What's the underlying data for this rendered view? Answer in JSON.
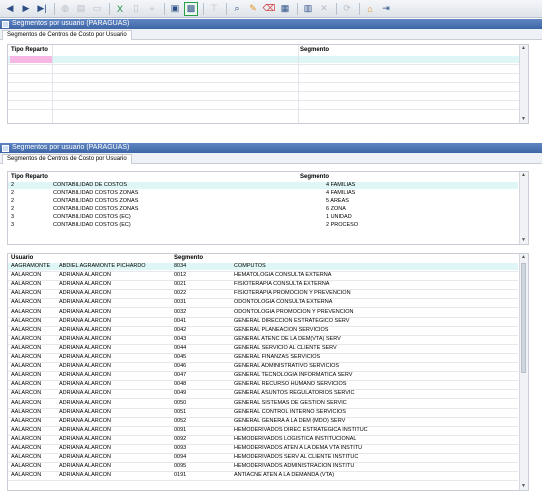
{
  "toolbar": {
    "buttons": [
      {
        "name": "first-record",
        "icon": "first-record-icon",
        "glyph": "◀",
        "enabled": true
      },
      {
        "name": "next-record",
        "icon": "next-record-icon",
        "glyph": "▶",
        "enabled": true
      },
      {
        "name": "last-record",
        "icon": "last-record-icon",
        "glyph": "▶|",
        "enabled": true
      },
      {
        "name": "globe",
        "icon": "globe-icon",
        "glyph": "◍",
        "enabled": false
      },
      {
        "name": "print",
        "icon": "print-icon",
        "glyph": "▤",
        "enabled": false
      },
      {
        "name": "screen",
        "icon": "screen-icon",
        "glyph": "▭",
        "enabled": false
      },
      {
        "name": "excel",
        "icon": "excel-icon",
        "glyph": "X",
        "enabled": true
      },
      {
        "name": "copy",
        "icon": "copy-icon",
        "glyph": "▯",
        "enabled": false
      },
      {
        "name": "add",
        "icon": "add-icon",
        "glyph": "+",
        "enabled": false
      },
      {
        "name": "save-disk",
        "icon": "disk-icon",
        "glyph": "▣",
        "enabled": true
      },
      {
        "name": "selected-tool",
        "icon": "database-icon",
        "glyph": "▩",
        "enabled": true,
        "selected": true
      },
      {
        "name": "filter",
        "icon": "filter-icon",
        "glyph": "⊤",
        "enabled": false
      },
      {
        "name": "search",
        "icon": "search-icon",
        "glyph": "⌕",
        "enabled": true
      },
      {
        "name": "edit",
        "icon": "pencil-icon",
        "glyph": "✎",
        "enabled": true
      },
      {
        "name": "erase",
        "icon": "eraser-icon",
        "glyph": "⌫",
        "enabled": true
      },
      {
        "name": "form",
        "icon": "form-icon",
        "glyph": "▦",
        "enabled": true
      },
      {
        "name": "save",
        "icon": "save-icon",
        "glyph": "▥",
        "enabled": true
      },
      {
        "name": "delete",
        "icon": "delete-icon",
        "glyph": "✕",
        "enabled": false
      },
      {
        "name": "refresh",
        "icon": "refresh-icon",
        "glyph": "⟳",
        "enabled": false
      },
      {
        "name": "home",
        "icon": "home-icon",
        "glyph": "⌂",
        "enabled": true
      },
      {
        "name": "exit",
        "icon": "exit-icon",
        "glyph": "⇥",
        "enabled": true
      }
    ]
  },
  "panel1": {
    "title": "Segmentos por usuario (PARAGUAS)",
    "tab": "Segmentos de Centros de Costo por Usuario",
    "col_tipo": "Tipo Reparto",
    "col_segmento": "Segmento"
  },
  "panel2": {
    "title": "Segmentos por usuario (PARAGUAS)",
    "tab": "Segmentos de Centros de Costo por Usuario",
    "col_tipo": "Tipo Reparto",
    "col_segmento": "Segmento",
    "reparto_rows": [
      {
        "code": "2",
        "desc": "CONTABILIDAD DE COSTOS",
        "seg": "4 FAMILIAS"
      },
      {
        "code": "2",
        "desc": "CONTABILIDAD COSTOS ZONAS",
        "seg": "4 FAMILIAS"
      },
      {
        "code": "2",
        "desc": "CONTABILIDAD COSTOS ZONAS",
        "seg": "5 AREAS"
      },
      {
        "code": "2",
        "desc": "CONTABILIDAD COSTOS ZONAS",
        "seg": "6 ZONA"
      },
      {
        "code": "3",
        "desc": "CONTABILIDAD COSTOS (EC)",
        "seg": "1 UNIDAD"
      },
      {
        "code": "3",
        "desc": "CONTABILIDAD COSTOS (EC)",
        "seg": "2 PROCESO"
      }
    ],
    "col_usuario": "Usuario",
    "col_segmento2": "Segmento",
    "user_rows": [
      {
        "user": "AAGRAMONTE",
        "name": "ABDIEL AGRAMONTE PICHARDO",
        "code": "8034",
        "desc": "COMPUTOS"
      },
      {
        "user": "AALARCON",
        "name": "ADRIANA ALARCON",
        "code": "0012",
        "desc": "HEMATOLOGIA CONSULTA EXTERNA"
      },
      {
        "user": "AALARCON",
        "name": "ADRIANA ALARCON",
        "code": "0021",
        "desc": "FISIOTERAPIA CONSULTA EXTERNA"
      },
      {
        "user": "AALARCON",
        "name": "ADRIANA ALARCON",
        "code": "0022",
        "desc": "FISIOTERAPIA PROMOCION Y PREVENCION"
      },
      {
        "user": "AALARCON",
        "name": "ADRIANA ALARCON",
        "code": "0031",
        "desc": "ODONTOLOGIA CONSULTA EXTERNA"
      },
      {
        "user": "AALARCON",
        "name": "ADRIANA ALARCON",
        "code": "0032",
        "desc": "ODONTOLOGIA PROMOCION Y PREVENCION"
      },
      {
        "user": "AALARCON",
        "name": "ADRIANA ALARCON",
        "code": "0041",
        "desc": "GENERAL DIRECCION ESTRATEGICO SERV"
      },
      {
        "user": "AALARCON",
        "name": "ADRIANA ALARCON",
        "code": "0042",
        "desc": "GENERAL PLANEACION SERVICIOS"
      },
      {
        "user": "AALARCON",
        "name": "ADRIANA ALARCON",
        "code": "0043",
        "desc": "GENERAL ATENC DE LA DEM(VTA) SERV"
      },
      {
        "user": "AALARCON",
        "name": "ADRIANA ALARCON",
        "code": "0044",
        "desc": "GENERAL SERVICIO AL CLIENTE SERV"
      },
      {
        "user": "AALARCON",
        "name": "ADRIANA ALARCON",
        "code": "0045",
        "desc": "GENERAL FINANZAS SERVICIOS"
      },
      {
        "user": "AALARCON",
        "name": "ADRIANA ALARCON",
        "code": "0046",
        "desc": "GENERAL ADMINISTRATIVO SERVICIOS"
      },
      {
        "user": "AALARCON",
        "name": "ADRIANA ALARCON",
        "code": "0047",
        "desc": "GENERAL TECNOLOGIA INFORMATICA SERV"
      },
      {
        "user": "AALARCON",
        "name": "ADRIANA ALARCON",
        "code": "0048",
        "desc": "GENERAL RECURSO HUMANO SERVICIOS"
      },
      {
        "user": "AALARCON",
        "name": "ADRIANA ALARCON",
        "code": "0049",
        "desc": "GENERAL ASUNTOS REGULATORIOS SERVIC"
      },
      {
        "user": "AALARCON",
        "name": "ADRIANA ALARCON",
        "code": "0050",
        "desc": "GENERAL SISTEMAS DE GESTION SERVIC"
      },
      {
        "user": "AALARCON",
        "name": "ADRIANA ALARCON",
        "code": "0051",
        "desc": "GENERAL CONTROL INTERNO SERVICIOS"
      },
      {
        "user": "AALARCON",
        "name": "ADRIANA ALARCON",
        "code": "0052",
        "desc": "GENERAL GENERA A LA DEM (MDO) SERV"
      },
      {
        "user": "AALARCON",
        "name": "ADRIANA ALARCON",
        "code": "0091",
        "desc": "HEMODERIVADOS DIREC ESTRATEGICA INSTITUC"
      },
      {
        "user": "AALARCON",
        "name": "ADRIANA ALARCON",
        "code": "0092",
        "desc": "HEMODERIVADOS LOGISTICA INSTITUCIONAL"
      },
      {
        "user": "AALARCON",
        "name": "ADRIANA ALARCON",
        "code": "0093",
        "desc": "HEMODERIVADOS ATEN A LA DEMA VTA INSTITU"
      },
      {
        "user": "AALARCON",
        "name": "ADRIANA ALARCON",
        "code": "0094",
        "desc": "HEMODERIVADOS SERV AL CLIENTE INSTITUC"
      },
      {
        "user": "AALARCON",
        "name": "ADRIANA ALARCON",
        "code": "0095",
        "desc": "HEMODERIVADOS ADMINISTRACION INSTITU"
      },
      {
        "user": "AALARCON",
        "name": "ADRIANA ALARCON",
        "code": "0191",
        "desc": "ANTIACNE ATEN A LA DEMANDA (VTA)"
      }
    ]
  }
}
